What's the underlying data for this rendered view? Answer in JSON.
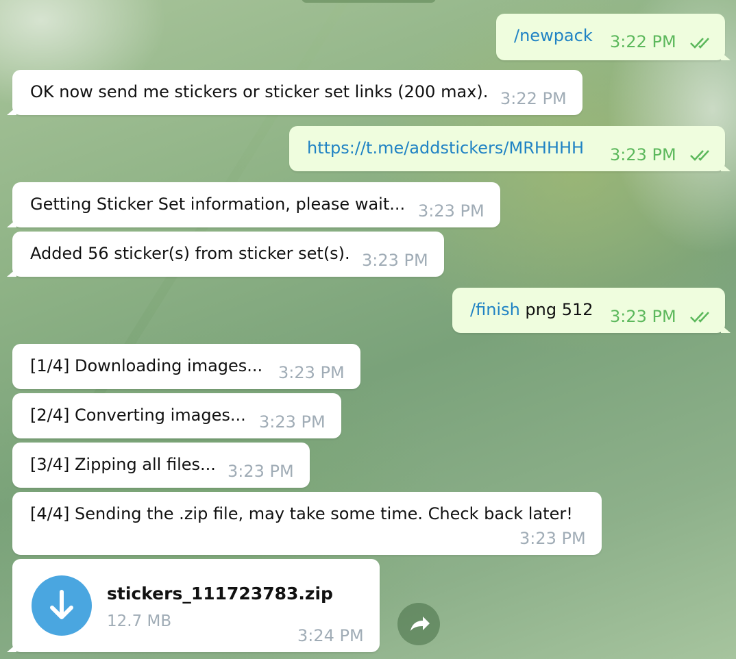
{
  "messages": [
    {
      "direction": "out",
      "text": "/newpack",
      "time": "3:22 PM"
    },
    {
      "direction": "in",
      "text": "OK now send me stickers or sticker set links (200 max).",
      "time": "3:22 PM"
    },
    {
      "direction": "out",
      "text": "https://t.me/addstickers/MRHHHH",
      "time": "3:23 PM"
    },
    {
      "direction": "in",
      "text": "Getting Sticker Set information, please wait...",
      "time": "3:23 PM"
    },
    {
      "direction": "in",
      "text": "Added 56 sticker(s) from sticker set(s).",
      "time": "3:23 PM"
    },
    {
      "direction": "out",
      "command": "/finish",
      "text": " png 512",
      "time": "3:23 PM"
    },
    {
      "direction": "in",
      "text": "[1/4] Downloading images...",
      "time": "3:23 PM"
    },
    {
      "direction": "in",
      "text": "[2/4] Converting images...",
      "time": "3:23 PM"
    },
    {
      "direction": "in",
      "text": "[3/4] Zipping all files...",
      "time": "3:23 PM"
    },
    {
      "direction": "in",
      "text": "[4/4] Sending the .zip file, may take some time. Check back later!",
      "time": "3:23 PM"
    }
  ],
  "file": {
    "name": "stickers_111723783.zip",
    "size": "12.7 MB",
    "time": "3:24 PM",
    "icon": "download-arrow-icon"
  },
  "icons": {
    "read_status": "double-check-icon",
    "share": "share-arrow-icon"
  },
  "colors": {
    "outgoing_bubble": "#effdde",
    "incoming_bubble": "#ffffff",
    "link": "#1f82c4",
    "time_outgoing": "#5cb85c",
    "time_incoming": "#a0acb6",
    "download_circle": "#4aa6e0"
  }
}
